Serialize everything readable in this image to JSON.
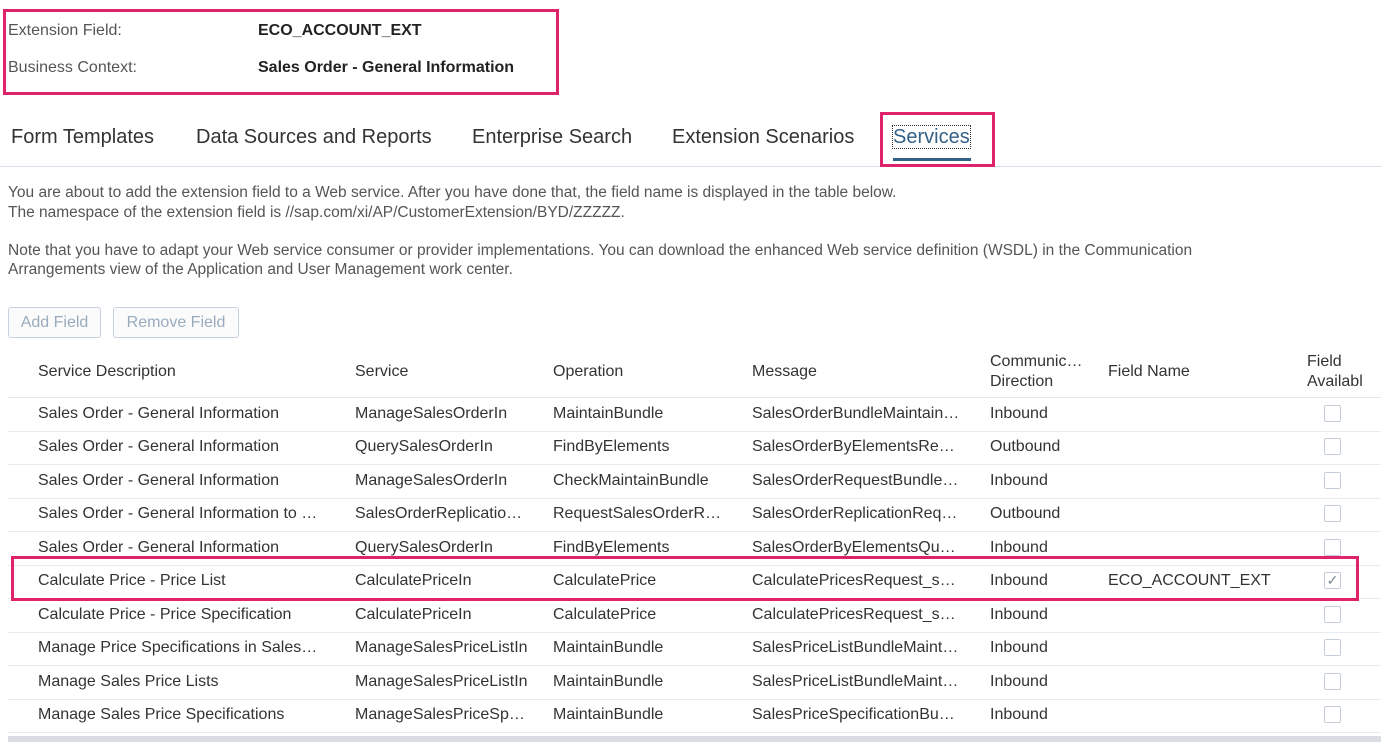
{
  "context": {
    "extension_field_label": "Extension Field:",
    "extension_field_value": "ECO_ACCOUNT_EXT",
    "business_context_label": "Business Context:",
    "business_context_value": "Sales Order - General Information"
  },
  "tabs": [
    {
      "label": "Form Templates"
    },
    {
      "label": "Data Sources and Reports"
    },
    {
      "label": "Enterprise Search"
    },
    {
      "label": "Extension Scenarios"
    },
    {
      "label": "Services",
      "active": true
    }
  ],
  "info": {
    "line1": "You are about to add the extension field to a Web service. After you have done that, the field name is displayed in the table below.",
    "line2": "The namespace of the extension field is //sap.com/xi/AP/CustomerExtension/BYD/ZZZZZ.",
    "line3": "Note that you have to adapt your Web service consumer or provider implementations. You can download the enhanced Web service definition (WSDL) in the Communication",
    "line4": "Arrangements view of the Application and User Management work center."
  },
  "toolbar": {
    "add_field": "Add Field",
    "remove_field": "Remove Field"
  },
  "table": {
    "headers": {
      "service_description": "Service Description",
      "service": "Service",
      "operation": "Operation",
      "message": "Message",
      "direction_line1": "Communic…",
      "direction_line2": "Direction",
      "field_name": "Field Name",
      "available_line1": "Field",
      "available_line2": "Availabl"
    },
    "rows": [
      {
        "description": "Sales Order - General Information",
        "service": "ManageSalesOrderIn",
        "operation": "MaintainBundle",
        "message": "SalesOrderBundleMaintain…",
        "direction": "Inbound",
        "field_name": "",
        "checked": false
      },
      {
        "description": "Sales Order - General Information",
        "service": "QuerySalesOrderIn",
        "operation": "FindByElements",
        "message": "SalesOrderByElementsRe…",
        "direction": "Outbound",
        "field_name": "",
        "checked": false
      },
      {
        "description": "Sales Order - General Information",
        "service": "ManageSalesOrderIn",
        "operation": "CheckMaintainBundle",
        "message": "SalesOrderRequestBundle…",
        "direction": "Inbound",
        "field_name": "",
        "checked": false
      },
      {
        "description": "Sales Order - General Information to …",
        "service": "SalesOrderReplicatio…",
        "operation": "RequestSalesOrderR…",
        "message": "SalesOrderReplicationReq…",
        "direction": "Outbound",
        "field_name": "",
        "checked": false
      },
      {
        "description": "Sales Order - General Information",
        "service": "QuerySalesOrderIn",
        "operation": "FindByElements",
        "message": "SalesOrderByElementsQu…",
        "direction": "Inbound",
        "field_name": "",
        "checked": false
      },
      {
        "description": "Calculate Price - Price List",
        "service": "CalculatePriceIn",
        "operation": "CalculatePrice",
        "message": "CalculatePricesRequest_s…",
        "direction": "Inbound",
        "field_name": "ECO_ACCOUNT_EXT",
        "checked": true
      },
      {
        "description": "Calculate Price - Price Specification",
        "service": "CalculatePriceIn",
        "operation": "CalculatePrice",
        "message": "CalculatePricesRequest_s…",
        "direction": "Inbound",
        "field_name": "",
        "checked": false
      },
      {
        "description": "Manage Price Specifications in Sales…",
        "service": "ManageSalesPriceListIn",
        "operation": "MaintainBundle",
        "message": "SalesPriceListBundleMaint…",
        "direction": "Inbound",
        "field_name": "",
        "checked": false
      },
      {
        "description": "Manage Sales Price Lists",
        "service": "ManageSalesPriceListIn",
        "operation": "MaintainBundle",
        "message": "SalesPriceListBundleMaint…",
        "direction": "Inbound",
        "field_name": "",
        "checked": false
      },
      {
        "description": "Manage Sales Price Specifications",
        "service": "ManageSalesPriceSp…",
        "operation": "MaintainBundle",
        "message": "SalesPriceSpecificationBu…",
        "direction": "Inbound",
        "field_name": "",
        "checked": false
      }
    ]
  },
  "colors": {
    "highlight": "#e0226a",
    "active_tab": "#346187",
    "disabled_button_text": "#9aabbd"
  },
  "icons": {
    "checkbox_checked": "check-icon"
  }
}
